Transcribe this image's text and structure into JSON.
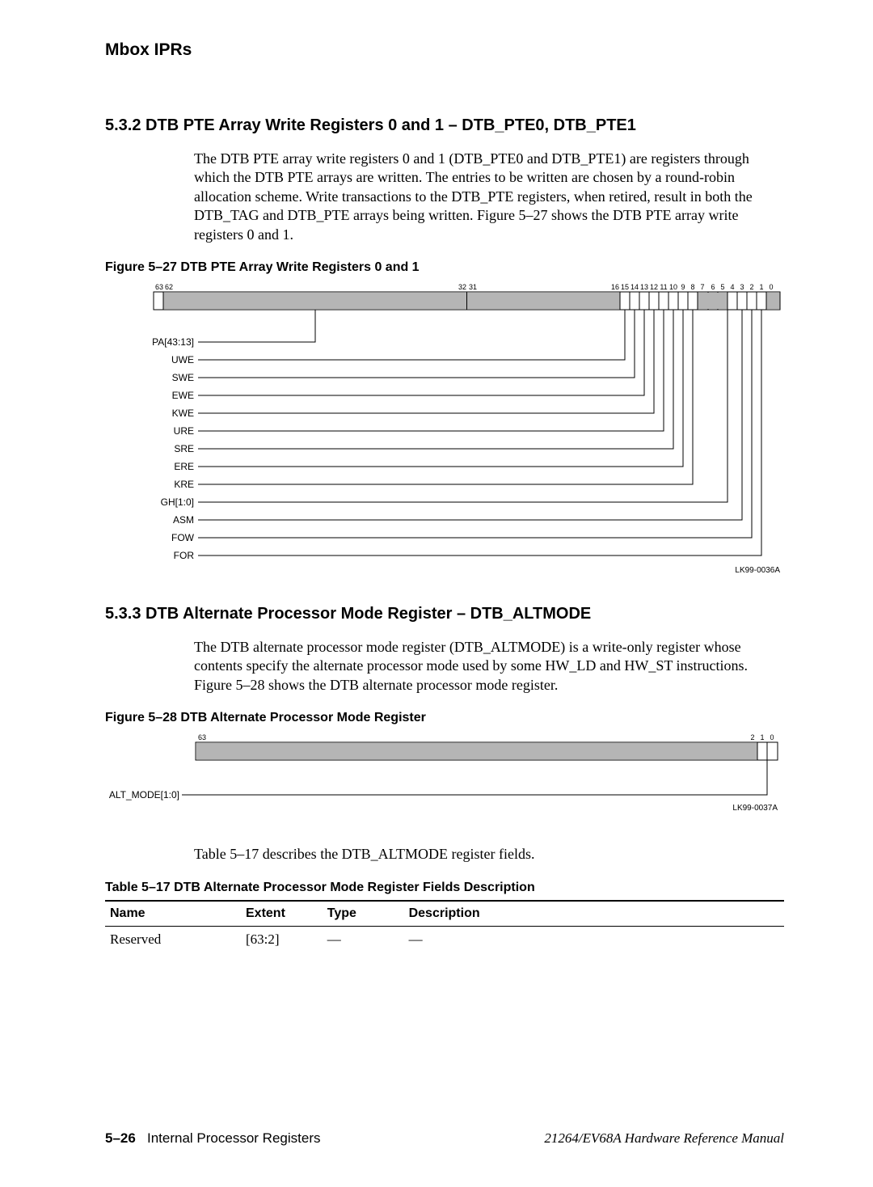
{
  "header": {
    "title": "Mbox IPRs"
  },
  "section_532": {
    "heading": "5.3.2  DTB PTE Array Write Registers 0 and 1 – DTB_PTE0, DTB_PTE1",
    "para": "The DTB PTE array write registers 0 and 1 (DTB_PTE0 and DTB_PTE1) are registers through which the DTB PTE arrays are written. The entries to be written are chosen by a round-robin allocation scheme. Write transactions to the DTB_PTE registers, when retired, result in both the DTB_TAG and DTB_PTE arrays being written. Figure 5–27 shows the DTB PTE array write registers 0 and 1."
  },
  "figure_527": {
    "caption": "Figure 5–27  DTB PTE Array Write Registers 0 and 1",
    "id": "LK99-0036A",
    "top_bits_left": [
      "63",
      "62"
    ],
    "top_bits_mid": [
      "32",
      "31"
    ],
    "top_bits_right": [
      "16",
      "15",
      "14",
      "13",
      "12",
      "11",
      "10",
      "9",
      "8",
      "7",
      "6",
      "5",
      "4",
      "3",
      "2",
      "1",
      "0"
    ],
    "fields": [
      "PA[43:13]",
      "UWE",
      "SWE",
      "EWE",
      "KWE",
      "URE",
      "SRE",
      "ERE",
      "KRE",
      "GH[1:0]",
      "ASM",
      "FOW",
      "FOR"
    ]
  },
  "section_533": {
    "heading": "5.3.3  DTB Alternate Processor Mode Register – DTB_ALTMODE",
    "para": "The DTB alternate processor mode register (DTB_ALTMODE) is a write-only register whose contents specify the alternate processor mode used by some HW_LD and HW_ST instructions. Figure 5–28 shows the DTB alternate processor mode register."
  },
  "figure_528": {
    "caption": "Figure 5–28  DTB Alternate Processor Mode Register",
    "id": "LK99-0037A",
    "bit_left": "63",
    "bits_right": [
      "2",
      "1",
      "0"
    ],
    "field": "ALT_MODE[1:0]"
  },
  "para_after_528": "Table 5–17 describes the DTB_ALTMODE register fields.",
  "table_517": {
    "title": "Table 5–17  DTB Alternate Processor Mode Register Fields Description",
    "headers": [
      "Name",
      "Extent",
      "Type",
      "Description"
    ],
    "row1": {
      "name": "Reserved",
      "extent": "[63:2]",
      "type": "—",
      "desc": "—"
    }
  },
  "footer": {
    "page": "5–26",
    "section": "Internal Processor Registers",
    "manual": "21264/EV68A Hardware Reference Manual"
  }
}
